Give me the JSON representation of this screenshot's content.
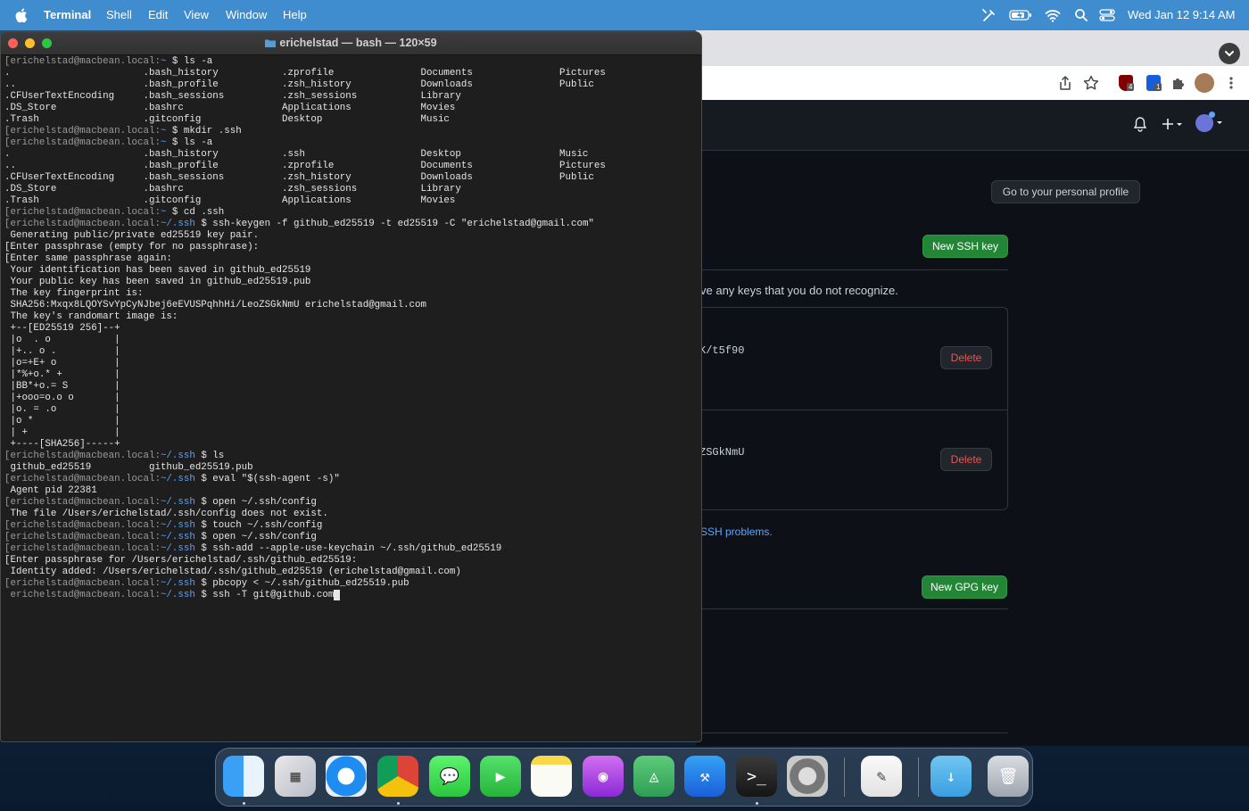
{
  "menubar": {
    "apple": "",
    "app": "Terminal",
    "items": [
      "Shell",
      "Edit",
      "View",
      "Window",
      "Help"
    ],
    "clock": "Wed Jan 12  9:14 AM",
    "status_icons": [
      "stylus-icon",
      "battery-icon",
      "wifi-icon",
      "spotlight-icon",
      "control-center-icon"
    ]
  },
  "terminal": {
    "title": "erichelstad — bash — 120×59",
    "lines": [
      {
        "p": "[erichelstad@macbean.local:",
        "d": "~",
        "c": " $ ls -a"
      },
      {
        "o": ".                       .bash_history           .zprofile               Documents               Pictures"
      },
      {
        "o": "..                      .bash_profile           .zsh_history            Downloads               Public"
      },
      {
        "o": ".CFUserTextEncoding     .bash_sessions          .zsh_sessions           Library"
      },
      {
        "o": ".DS_Store               .bashrc                 Applications            Movies"
      },
      {
        "o": ".Trash                  .gitconfig              Desktop                 Music"
      },
      {
        "p": "[erichelstad@macbean.local:",
        "d": "~",
        "c": " $ mkdir .ssh"
      },
      {
        "p": "[erichelstad@macbean.local:",
        "d": "~",
        "c": " $ ls -a"
      },
      {
        "o": ".                       .bash_history           .ssh                    Desktop                 Music"
      },
      {
        "o": "..                      .bash_profile           .zprofile               Documents               Pictures"
      },
      {
        "o": ".CFUserTextEncoding     .bash_sessions          .zsh_history            Downloads               Public"
      },
      {
        "o": ".DS_Store               .bashrc                 .zsh_sessions           Library"
      },
      {
        "o": ".Trash                  .gitconfig              Applications            Movies"
      },
      {
        "p": "[erichelstad@macbean.local:",
        "d": "~",
        "c": " $ cd .ssh"
      },
      {
        "p": "[erichelstad@macbean.local:",
        "d": "~/.ssh",
        "c": " $ ssh-keygen -f github_ed25519 -t ed25519 -C \"erichelstad@gmail.com\""
      },
      {
        "o": " Generating public/private ed25519 key pair."
      },
      {
        "o": "[Enter passphrase (empty for no passphrase):"
      },
      {
        "o": "[Enter same passphrase again:"
      },
      {
        "o": " Your identification has been saved in github_ed25519"
      },
      {
        "o": " Your public key has been saved in github_ed25519.pub"
      },
      {
        "o": " The key fingerprint is:"
      },
      {
        "o": " SHA256:Mxqx8LQOYSvYpCyNJbej6eEVUSPqhhHi/LeoZSGkNmU erichelstad@gmail.com"
      },
      {
        "o": " The key's randomart image is:"
      },
      {
        "o": " +--[ED25519 256]--+"
      },
      {
        "o": " |o  . o           |"
      },
      {
        "o": " |+.. o .          |"
      },
      {
        "o": " |o=+E+ o          |"
      },
      {
        "o": " |*%+o.* +         |"
      },
      {
        "o": " |BB*+o.= S        |"
      },
      {
        "o": " |+ooo=o.o o       |"
      },
      {
        "o": " |o. = .o          |"
      },
      {
        "o": " |o *              |"
      },
      {
        "o": " | +               |"
      },
      {
        "o": " +----[SHA256]-----+"
      },
      {
        "p": "[erichelstad@macbean.local:",
        "d": "~/.ssh",
        "c": " $ ls"
      },
      {
        "o": " github_ed25519          github_ed25519.pub"
      },
      {
        "p": "[erichelstad@macbean.local:",
        "d": "~/.ssh",
        "c": " $ eval \"$(ssh-agent -s)\""
      },
      {
        "o": " Agent pid 22381"
      },
      {
        "p": "[erichelstad@macbean.local:",
        "d": "~/.ssh",
        "c": " $ open ~/.ssh/config"
      },
      {
        "o": " The file /Users/erichelstad/.ssh/config does not exist."
      },
      {
        "p": "[erichelstad@macbean.local:",
        "d": "~/.ssh",
        "c": " $ touch ~/.ssh/config"
      },
      {
        "p": "[erichelstad@macbean.local:",
        "d": "~/.ssh",
        "c": " $ open ~/.ssh/config"
      },
      {
        "p": "[erichelstad@macbean.local:",
        "d": "~/.ssh",
        "c": " $ ssh-add --apple-use-keychain ~/.ssh/github_ed25519"
      },
      {
        "o": "[Enter passphrase for /Users/erichelstad/.ssh/github_ed25519:"
      },
      {
        "o": " Identity added: /Users/erichelstad/.ssh/github_ed25519 (erichelstad@gmail.com)"
      },
      {
        "p": "[erichelstad@macbean.local:",
        "d": "~/.ssh",
        "c": " $ pbcopy < ~/.ssh/github_ed25519.pub"
      },
      {
        "p": " erichelstad@macbean.local:",
        "d": "~/.ssh",
        "c": " $ ssh -T git@github.com",
        "cursor": true
      }
    ]
  },
  "browser": {
    "ext_badge_ublock": "4",
    "ext_badge_bitwarden": "1",
    "personal_profile_button": "Go to your personal profile",
    "new_ssh_key_button": "New SSH key",
    "warning_text": "ve any keys that you do not recognize.",
    "key1_fingerprint": "K/t5f90",
    "key2_fingerprint": "ZSGkNmU",
    "delete_label": "Delete",
    "troubleshoot_link": "SSH problems.",
    "new_gpg_key_button": "New GPG key"
  },
  "dock": {
    "apps": [
      "Finder",
      "Launchpad",
      "Safari",
      "Google Chrome",
      "Messages",
      "FaceTime",
      "Notes",
      "Podcasts",
      "Keystone",
      "Xcode",
      "Terminal",
      "System Preferences",
      "TextEdit",
      "Downloads",
      "Trash"
    ]
  }
}
